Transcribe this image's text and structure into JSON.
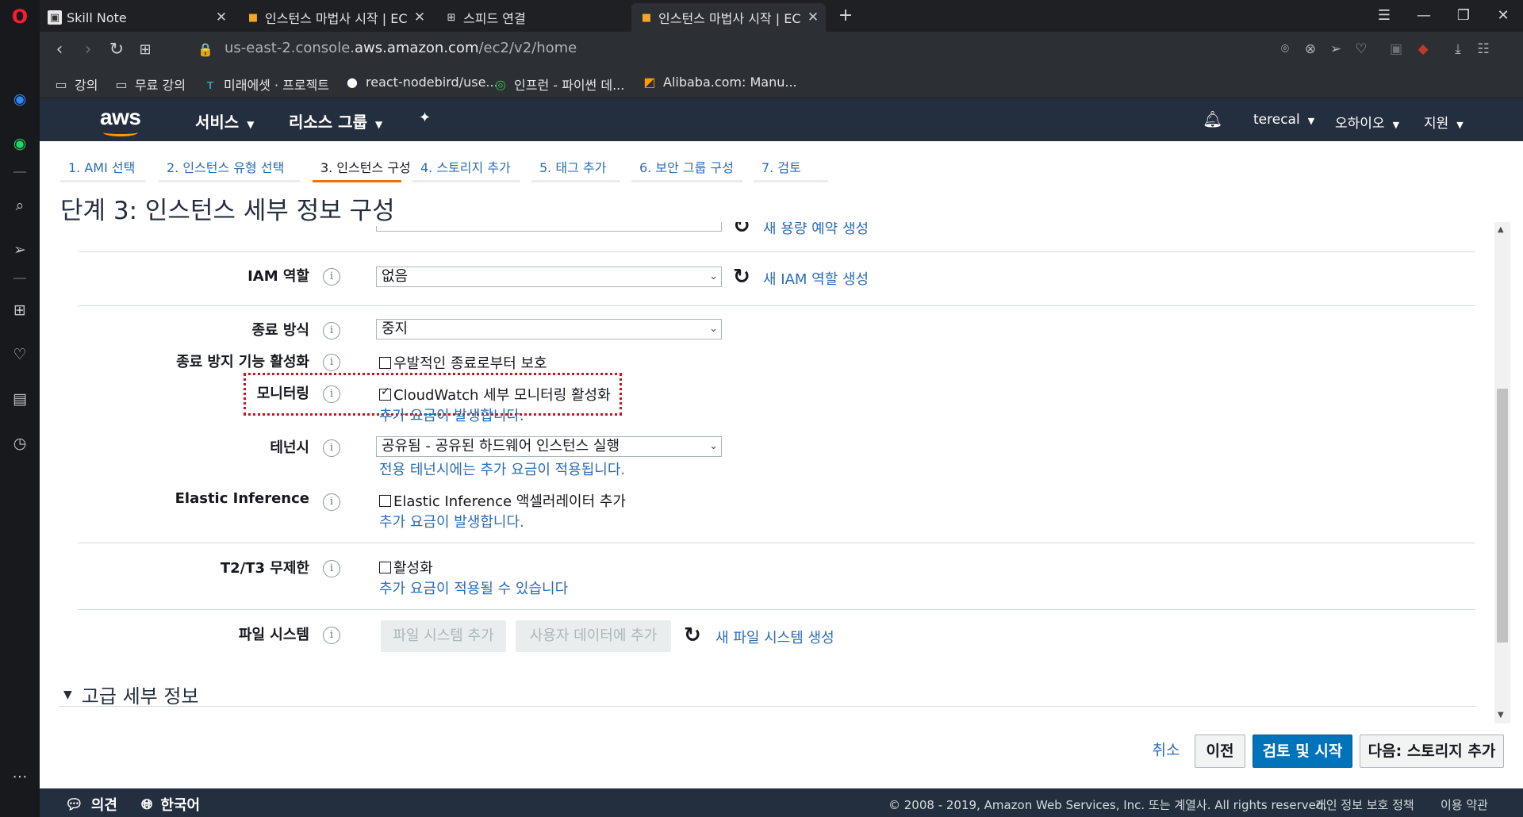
{
  "browser": {
    "tabs": [
      {
        "title": "Skill Note",
        "favicon": "skillnote-icon",
        "active": false
      },
      {
        "title": "인스턴스 마법사 시작 | EC",
        "favicon": "aws-box-icon",
        "active": false
      },
      {
        "title": "스피드 연결",
        "favicon": "speed-dial-icon",
        "active": false
      },
      {
        "title": "인스턴스 마법사 시작 | EC",
        "favicon": "aws-box-icon",
        "active": true
      }
    ],
    "url_prefix": "us-east-2.console.",
    "url_domain": "aws.amazon.com",
    "url_path": "/ec2/v2/home",
    "bookmarks": [
      {
        "label": "강의",
        "icon": "folder-icon"
      },
      {
        "label": "무료 강의",
        "icon": "folder-icon"
      },
      {
        "label": "미래에셋 · 프로젝트",
        "icon": "mirae-icon"
      },
      {
        "label": "react-nodebird/use...",
        "icon": "github-icon"
      },
      {
        "label": "인프런 - 파이썬 데...",
        "icon": "inflearn-icon"
      },
      {
        "label": "Alibaba.com: Manu...",
        "icon": "alibaba-icon"
      }
    ]
  },
  "aws_nav": {
    "logo": "aws",
    "services": "서비스",
    "resource_groups": "리소스 그룹",
    "user": "terecal",
    "region": "오하이오",
    "support": "지원"
  },
  "wizard": {
    "steps": [
      "1. AMI 선택",
      "2. 인스턴스 유형 선택",
      "3. 인스턴스 구성",
      "4. 스토리지 추가",
      "5. 태그 추가",
      "6. 보안 그룹 구성",
      "7. 검토"
    ],
    "current_step": 3,
    "title": "단계 3: 인스턴스 세부 정보 구성"
  },
  "form": {
    "top_partial_link": "새 용량 예약 생성",
    "iam_role": {
      "label": "IAM 역할",
      "value": "없음",
      "link": "새 IAM 역할 생성"
    },
    "shutdown_behavior": {
      "label": "종료 방식",
      "value": "중지"
    },
    "termination_protection": {
      "label": "종료 방지 기능 활성화",
      "checkbox": "우발적인 종료로부터 보호",
      "checked": false
    },
    "monitoring": {
      "label": "모니터링",
      "checkbox": "CloudWatch 세부 모니터링 활성화",
      "checked": true,
      "note": "추가 요금이 발생합니다."
    },
    "tenancy": {
      "label": "테넌시",
      "value": "공유됨 - 공유된 하드웨어 인스턴스 실행",
      "note": "전용 테넌시에는 추가 요금이 적용됩니다."
    },
    "elastic_inference": {
      "label": "Elastic Inference",
      "checkbox": "Elastic Inference 액셀러레이터 추가",
      "checked": false,
      "note": "추가 요금이 발생합니다."
    },
    "t2t3_unlimited": {
      "label": "T2/T3 무제한",
      "checkbox": "활성화",
      "checked": false,
      "note": "추가 요금이 적용될 수 있습니다"
    },
    "file_system": {
      "label": "파일 시스템",
      "add_button": "파일 시스템 추가",
      "user_data_button": "사용자 데이터에 추가",
      "link": "새 파일 시스템 생성"
    },
    "advanced": {
      "label": "고급 세부 정보"
    }
  },
  "actions": {
    "cancel": "취소",
    "previous": "이전",
    "review_launch": "검토 및 시작",
    "next": "다음: 스토리지 추가"
  },
  "console_footer": {
    "feedback": "의견",
    "language": "한국어",
    "copyright": "© 2008 - 2019, Amazon Web Services, Inc. 또는 계열사. All rights reserved.",
    "privacy": "개인 정보 보호 정책",
    "terms": "이용 약관"
  },
  "colors": {
    "aws_nav_bg": "#232f3e",
    "aws_orange": "#ff9900",
    "link_blue": "#2b6cb5",
    "primary_button": "#0073bb",
    "highlight_red": "#c7161e"
  }
}
